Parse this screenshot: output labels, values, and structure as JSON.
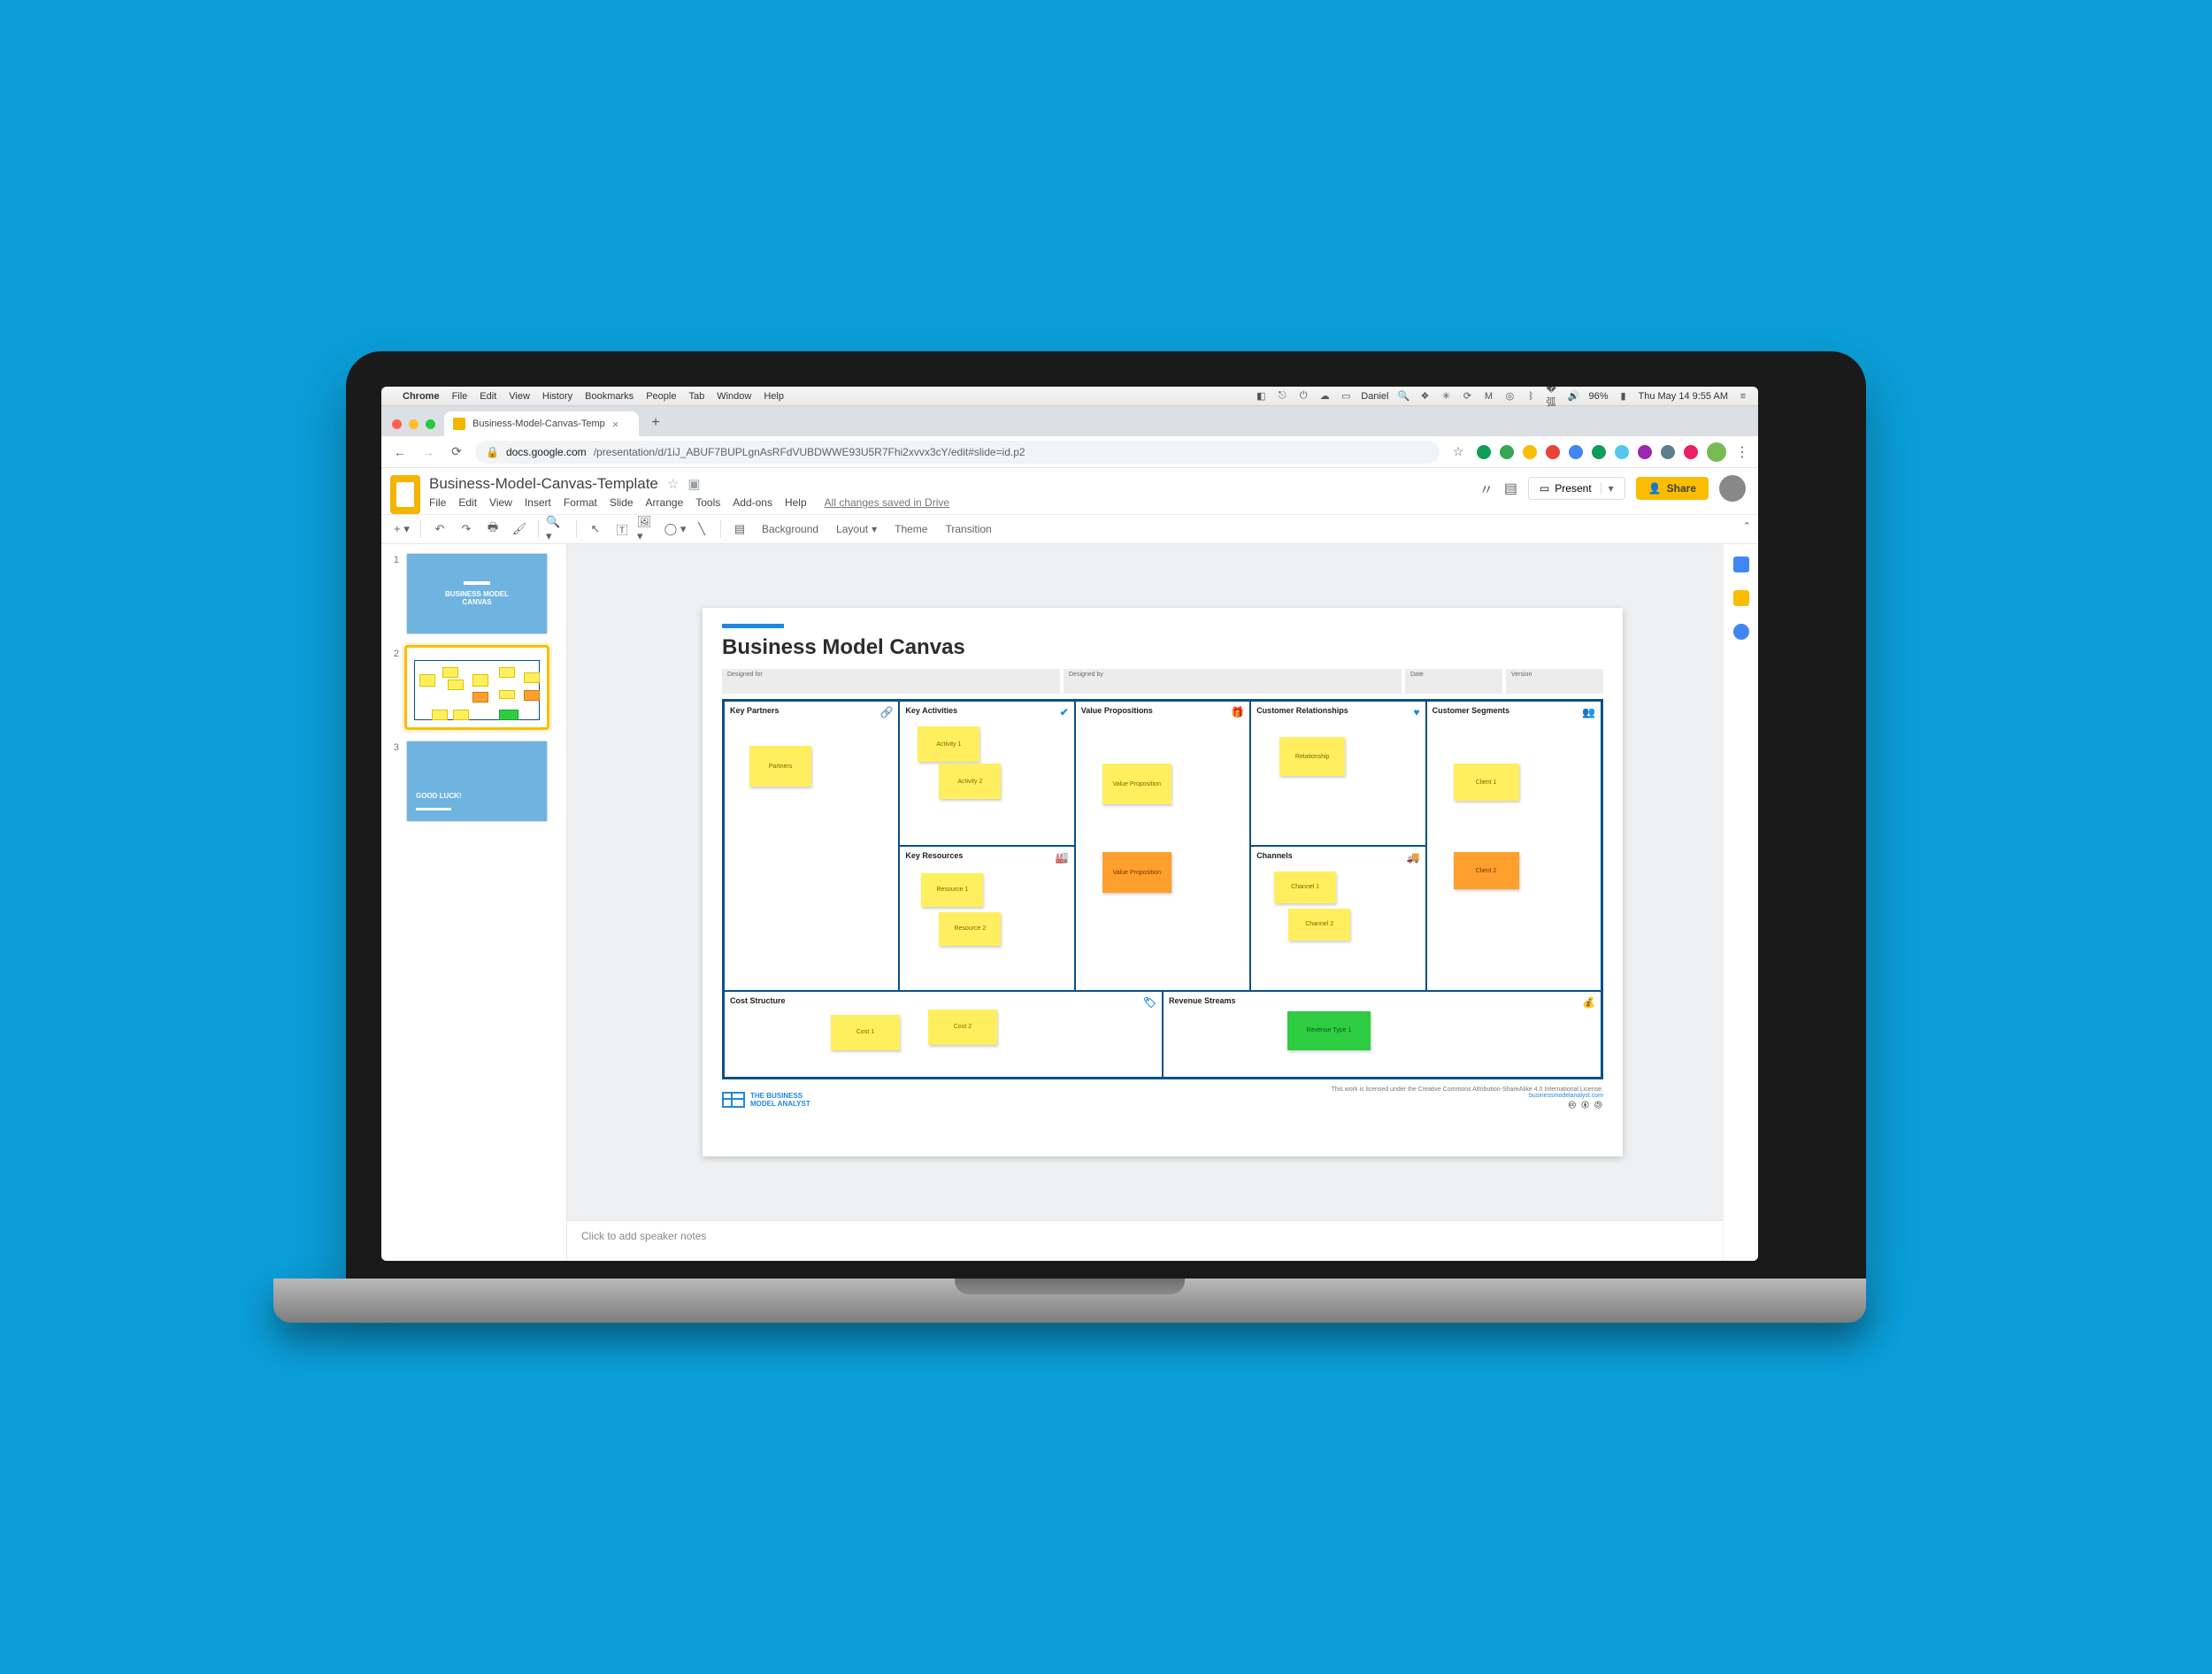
{
  "mac": {
    "app": "Chrome",
    "menus": [
      "File",
      "Edit",
      "View",
      "History",
      "Bookmarks",
      "People",
      "Tab",
      "Window",
      "Help"
    ],
    "user": "Daniel",
    "battery": "96%",
    "datetime": "Thu May 14  9:55 AM"
  },
  "chrome": {
    "tab_title": "Business-Model-Canvas-Temp",
    "url_host": "docs.google.com",
    "url_path": "/presentation/d/1iJ_ABUF7BUPLgnAsRFdVUBDWWE93U5R7Fhi2xvvx3cY/edit#slide=id.p2"
  },
  "slides": {
    "doc_title": "Business-Model-Canvas-Template",
    "menus": [
      "File",
      "Edit",
      "View",
      "Insert",
      "Format",
      "Slide",
      "Arrange",
      "Tools",
      "Add-ons",
      "Help"
    ],
    "saved": "All changes saved in Drive",
    "present": "Present",
    "share": "Share",
    "toolbar": {
      "background": "Background",
      "layout": "Layout",
      "theme": "Theme",
      "transition": "Transition"
    },
    "speaker_placeholder": "Click to add speaker notes",
    "thumbs": {
      "t1_line1": "BUSINESS MODEL",
      "t1_line2": "CANVAS",
      "t3": "GOOD LUCK!"
    }
  },
  "canvas": {
    "title": "Business Model Canvas",
    "meta": {
      "designed_for": "Designed for",
      "designed_by": "Designed by",
      "date": "Date",
      "version": "Version"
    },
    "sections": {
      "kp": "Key Partners",
      "ka": "Key Activities",
      "kr": "Key Resources",
      "vp": "Value Propositions",
      "cr": "Customer Relationships",
      "ch": "Channels",
      "cs": "Customer Segments",
      "cost": "Cost Structure",
      "rev": "Revenue Streams"
    },
    "notes": {
      "partners": "Partners",
      "activity1": "Activity 1",
      "activity2": "Activity 2",
      "resource1": "Resource 1",
      "resource2": "Resource 2",
      "vp1": "Value Proposition",
      "vp2": "Value Proposition",
      "relationship": "Relationship",
      "channel1": "Channel 1",
      "channel2": "Channel 2",
      "client1": "Client 1",
      "client2": "Client 2",
      "cost1": "Cost 1",
      "cost2": "Cost 2",
      "revenue": "Revenue Type 1"
    },
    "footer": {
      "brand1": "THE BUSINESS",
      "brand2": "MODEL ANALYST",
      "link": "businessmodelanalyst.com",
      "license": "This work is licensed under the Creative Commons Attribution-ShareAlike 4.0 International License."
    }
  }
}
